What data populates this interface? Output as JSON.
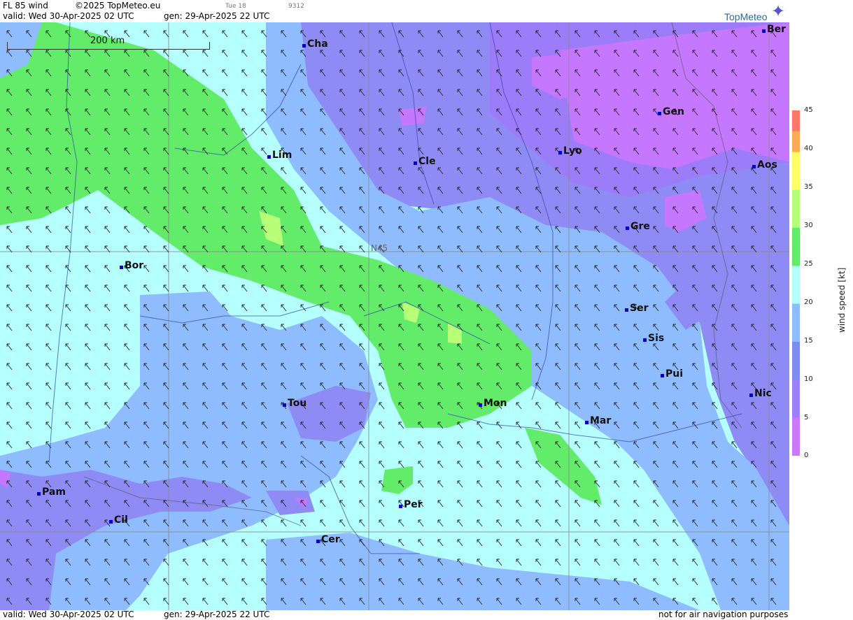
{
  "header": {
    "product": "FL 85 wind",
    "copyright": "©2025 TopMeteo.eu",
    "weekday": "Tue 18",
    "code": "9312",
    "valid": "valid:  Wed  30-Apr-2025  02 UTC",
    "gen": "gen: 29-Apr-2025 22 UTC",
    "logo": "TopMeteo"
  },
  "footer": {
    "valid": "valid:  Wed  30-Apr-2025  02 UTC",
    "gen": "gen: 29-Apr-2025 22 UTC",
    "disclaimer": "not for air navigation purposes"
  },
  "map": {
    "scale_label": "200 km",
    "latitude_label": "N45",
    "cities": [
      {
        "name": "Cha"
      },
      {
        "name": "Ber"
      },
      {
        "name": "Gen"
      },
      {
        "name": "Lim"
      },
      {
        "name": "Cle"
      },
      {
        "name": "Lyo"
      },
      {
        "name": "Aos"
      },
      {
        "name": "Gre"
      },
      {
        "name": "Bor"
      },
      {
        "name": "Ser"
      },
      {
        "name": "Sis"
      },
      {
        "name": "Pui"
      },
      {
        "name": "Tou"
      },
      {
        "name": "Mon"
      },
      {
        "name": "Nic"
      },
      {
        "name": "Mar"
      },
      {
        "name": "Pam"
      },
      {
        "name": "Per"
      },
      {
        "name": "Cil"
      },
      {
        "name": "Cer"
      }
    ]
  },
  "legend": {
    "title": "wind  speed  [kt]",
    "ticks": [
      "45",
      "40",
      "35",
      "30",
      "25",
      "20",
      "15",
      "10",
      "5",
      "0"
    ]
  }
}
